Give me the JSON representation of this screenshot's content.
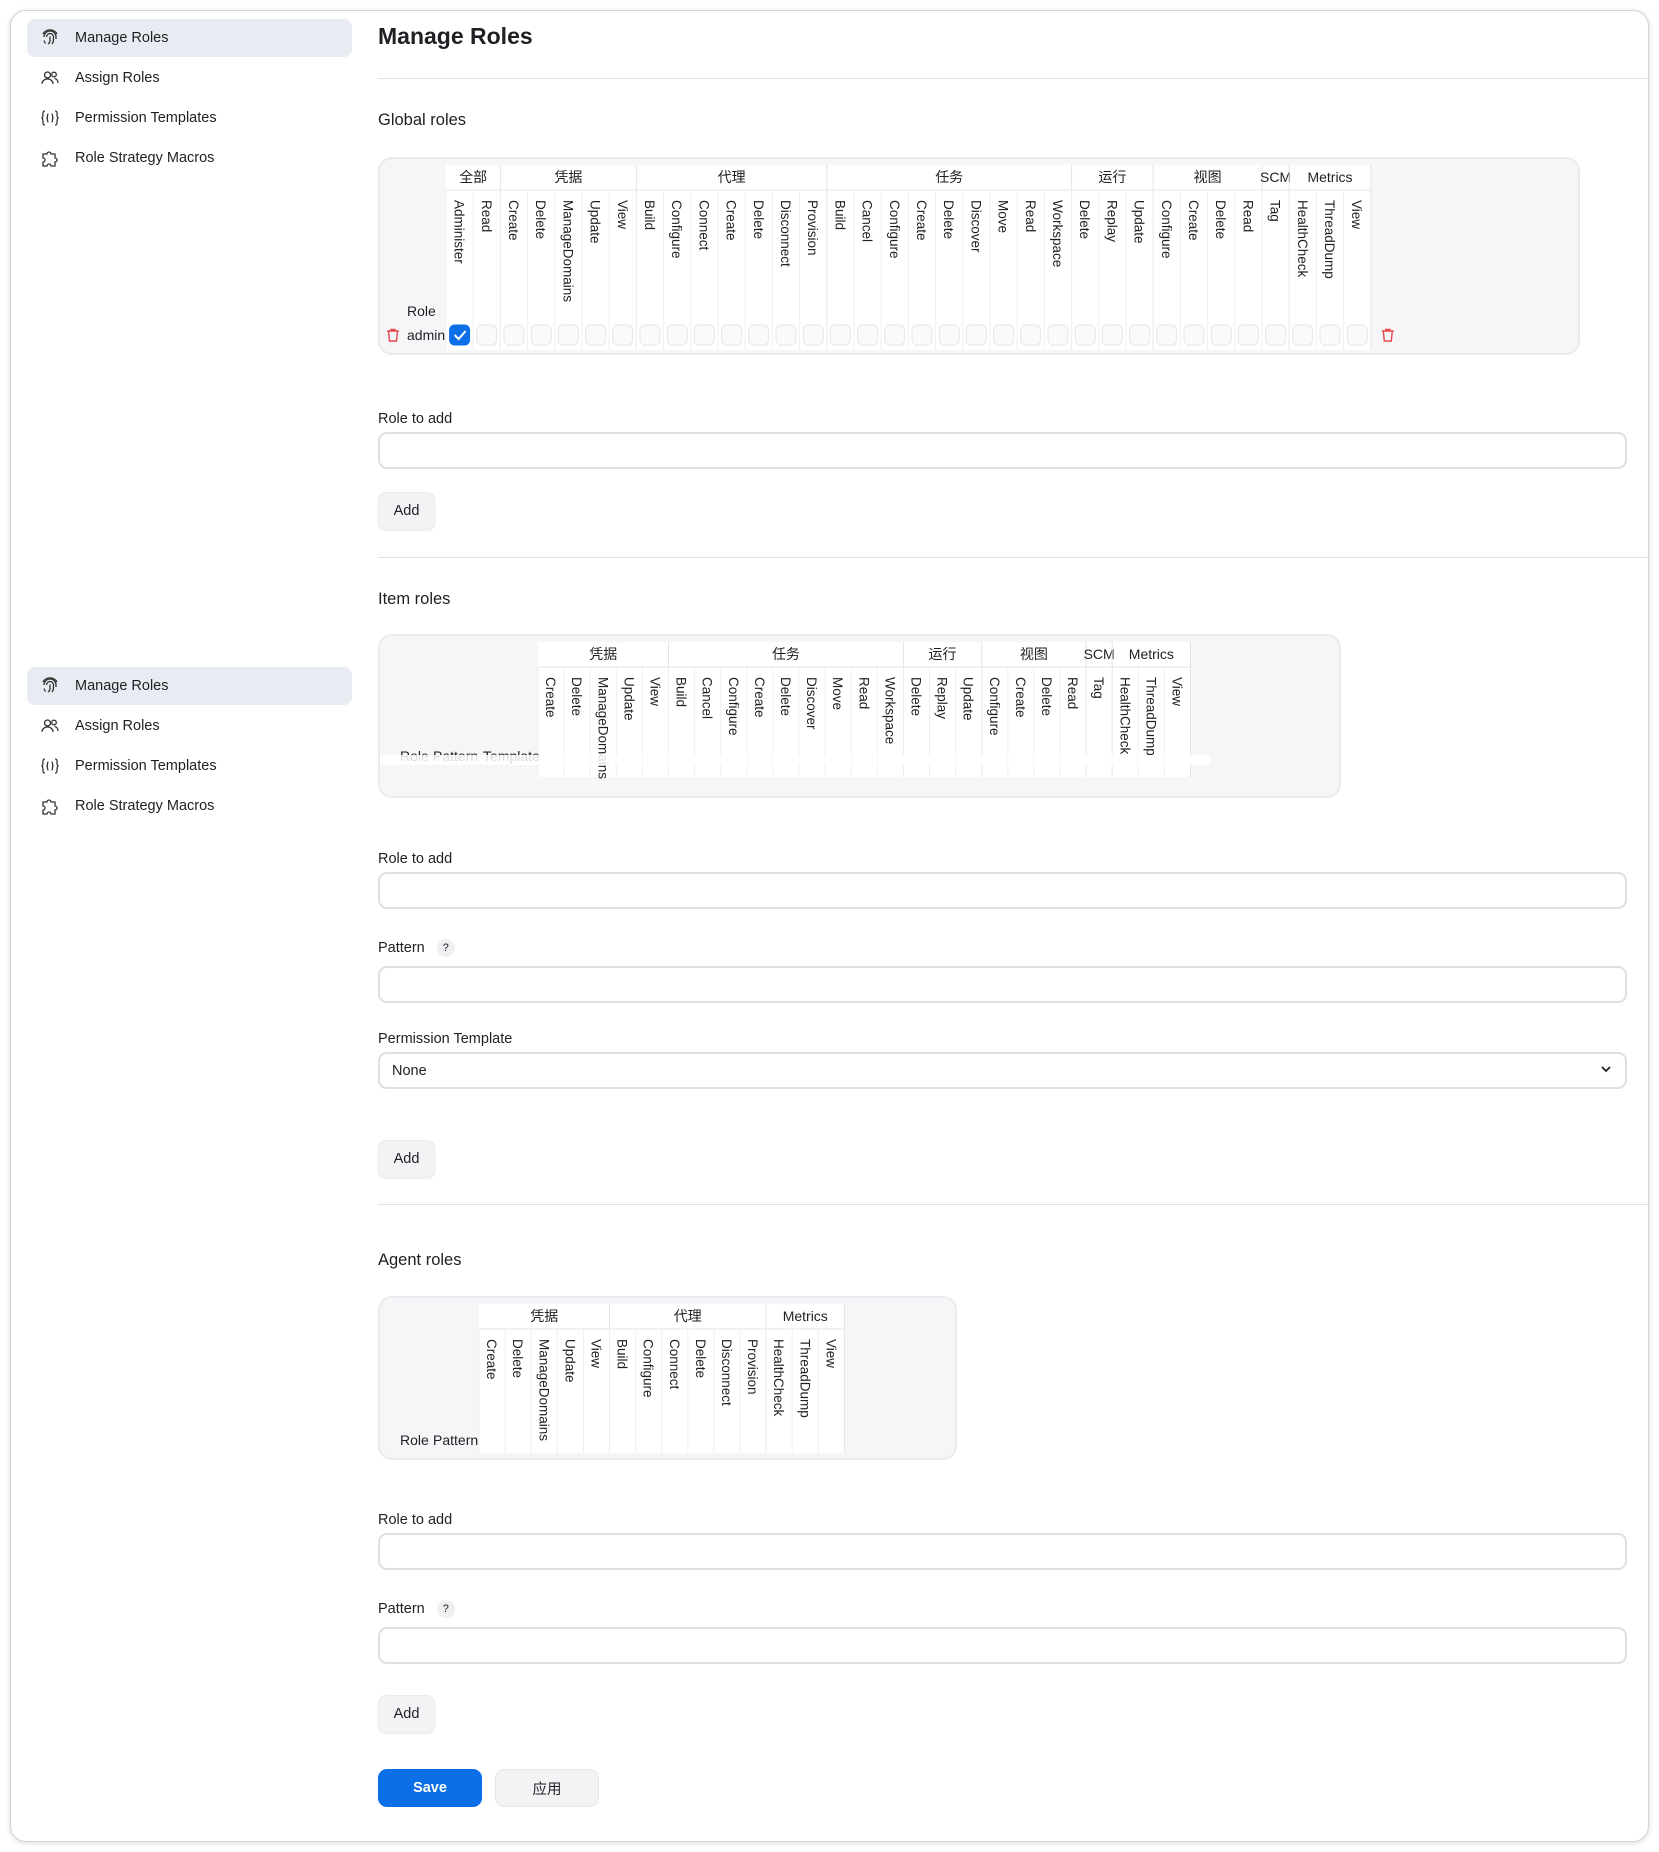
{
  "sidebar": {
    "items": [
      {
        "label": "Manage Roles",
        "icon": "fingerprint-icon",
        "active": true
      },
      {
        "label": "Assign Roles",
        "icon": "users-icon",
        "active": false
      },
      {
        "label": "Permission Templates",
        "icon": "braces-icon",
        "active": false
      },
      {
        "label": "Role Strategy Macros",
        "icon": "puzzle-icon",
        "active": false
      }
    ]
  },
  "page": {
    "title": "Manage Roles"
  },
  "global": {
    "title": "Global roles",
    "role_header": "Role",
    "groups": [
      {
        "name": "全部",
        "perms": [
          "Administer",
          "Read"
        ]
      },
      {
        "name": "凭据",
        "perms": [
          "Create",
          "Delete",
          "ManageDomains",
          "Update",
          "View"
        ]
      },
      {
        "name": "代理",
        "perms": [
          "Build",
          "Configure",
          "Connect",
          "Create",
          "Delete",
          "Disconnect",
          "Provision"
        ]
      },
      {
        "name": "任务",
        "perms": [
          "Build",
          "Cancel",
          "Configure",
          "Create",
          "Delete",
          "Discover",
          "Move",
          "Read",
          "Workspace"
        ]
      },
      {
        "name": "运行",
        "perms": [
          "Delete",
          "Replay",
          "Update"
        ]
      },
      {
        "name": "视图",
        "perms": [
          "Configure",
          "Create",
          "Delete",
          "Read"
        ]
      },
      {
        "name": "SCM",
        "perms": [
          "Tag"
        ]
      },
      {
        "name": "Metrics",
        "perms": [
          "HealthCheck",
          "ThreadDump",
          "View"
        ]
      }
    ],
    "rows": [
      {
        "role": "admin",
        "checked": [
          0
        ]
      }
    ],
    "role_to_add_label": "Role to add",
    "add_label": "Add"
  },
  "item": {
    "title": "Item roles",
    "headers": [
      "Role",
      "Pattern",
      "Template"
    ],
    "groups": [
      {
        "name": "凭据",
        "perms": [
          "Create",
          "Delete",
          "ManageDomains",
          "Update",
          "View"
        ]
      },
      {
        "name": "任务",
        "perms": [
          "Build",
          "Cancel",
          "Configure",
          "Create",
          "Delete",
          "Discover",
          "Move",
          "Read",
          "Workspace"
        ]
      },
      {
        "name": "运行",
        "perms": [
          "Delete",
          "Replay",
          "Update"
        ]
      },
      {
        "name": "视图",
        "perms": [
          "Configure",
          "Create",
          "Delete",
          "Read"
        ]
      },
      {
        "name": "SCM",
        "perms": [
          "Tag"
        ]
      },
      {
        "name": "Metrics",
        "perms": [
          "HealthCheck",
          "ThreadDump",
          "View"
        ]
      }
    ],
    "role_to_add_label": "Role to add",
    "pattern_label": "Pattern",
    "help": "?",
    "template_label": "Permission Template",
    "template_value": "None",
    "add_label": "Add"
  },
  "agent": {
    "title": "Agent roles",
    "headers": [
      "Role",
      "Pattern"
    ],
    "groups": [
      {
        "name": "凭据",
        "perms": [
          "Create",
          "Delete",
          "ManageDomains",
          "Update",
          "View"
        ]
      },
      {
        "name": "代理",
        "perms": [
          "Build",
          "Configure",
          "Connect",
          "Delete",
          "Disconnect",
          "Provision"
        ]
      },
      {
        "name": "Metrics",
        "perms": [
          "HealthCheck",
          "ThreadDump",
          "View"
        ]
      }
    ],
    "role_to_add_label": "Role to add",
    "pattern_label": "Pattern",
    "help": "?",
    "add_label": "Add"
  },
  "footer": {
    "save_label": "Save",
    "apply_label": "应用"
  },
  "colors": {
    "accent": "#0b6fe8",
    "delete": "#e5484d",
    "active_bg": "#e8ebf1"
  }
}
